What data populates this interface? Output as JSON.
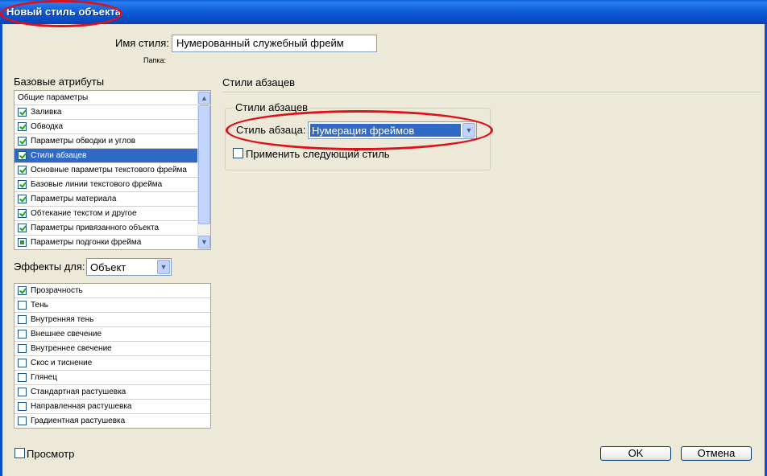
{
  "window": {
    "title": "Новый стиль объекта"
  },
  "style_name": {
    "label": "Имя стиля:",
    "value": "Нумерованный служебный фрейм"
  },
  "folder": {
    "label": "Папка:"
  },
  "base_attrs": {
    "heading": "Базовые атрибуты",
    "items": [
      {
        "label": "Общие параметры",
        "check": "none"
      },
      {
        "label": "Заливка",
        "check": "checked"
      },
      {
        "label": "Обводка",
        "check": "checked"
      },
      {
        "label": "Параметры обводки и углов",
        "check": "checked"
      },
      {
        "label": "Стили абзацев",
        "check": "checked",
        "selected": true
      },
      {
        "label": "Основные параметры текстового фрейма",
        "check": "checked"
      },
      {
        "label": "Базовые линии текстового фрейма",
        "check": "checked"
      },
      {
        "label": "Параметры материала",
        "check": "checked"
      },
      {
        "label": "Обтекание текстом и другое",
        "check": "checked"
      },
      {
        "label": "Параметры привязанного объекта",
        "check": "checked"
      },
      {
        "label": "Параметры подгонки фрейма",
        "check": "partial"
      }
    ]
  },
  "effects": {
    "label": "Эффекты для:",
    "target": "Объект",
    "items": [
      {
        "label": "Прозрачность",
        "check": "checked"
      },
      {
        "label": "Тень",
        "check": "unchecked"
      },
      {
        "label": "Внутренняя тень",
        "check": "unchecked"
      },
      {
        "label": "Внешнее свечение",
        "check": "unchecked"
      },
      {
        "label": "Внутреннее свечение",
        "check": "unchecked"
      },
      {
        "label": "Скос и тиснение",
        "check": "unchecked"
      },
      {
        "label": "Глянец",
        "check": "unchecked"
      },
      {
        "label": "Стандартная растушевка",
        "check": "unchecked"
      },
      {
        "label": "Направленная растушевка",
        "check": "unchecked"
      },
      {
        "label": "Градиентная растушевка",
        "check": "unchecked"
      }
    ]
  },
  "panel": {
    "heading": "Стили абзацев",
    "group_title": "Стили абзацев",
    "para_style_label": "Стиль абзаца:",
    "para_style_value": "Нумерация фреймов",
    "apply_next_label": "Применить следующий стиль"
  },
  "preview_label": "Просмотр",
  "ok_label": "OK",
  "cancel_label": "Отмена",
  "colors": {
    "title_blue": "#0a5fd8",
    "selection": "#316ac5",
    "annotation_red": "#e0101a",
    "check_green": "#21a121"
  }
}
